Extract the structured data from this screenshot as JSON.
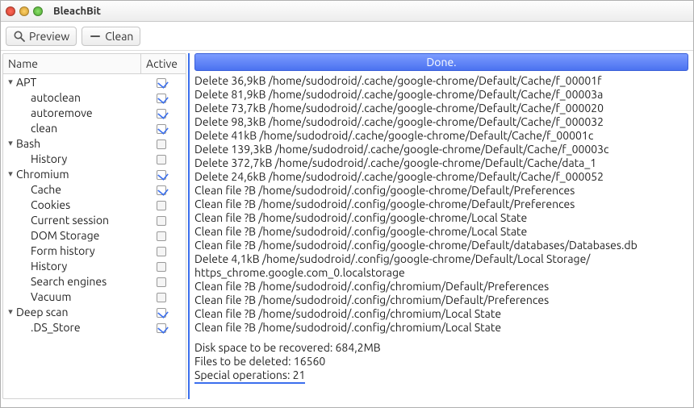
{
  "window": {
    "title": "BleachBit"
  },
  "toolbar": {
    "preview_label": "Preview",
    "clean_label": "Clean"
  },
  "tree": {
    "columns": {
      "name": "Name",
      "active": "Active"
    },
    "rows": [
      {
        "label": "APT",
        "level": 0,
        "checked": true,
        "expander": "▾"
      },
      {
        "label": "autoclean",
        "level": 1,
        "checked": true
      },
      {
        "label": "autoremove",
        "level": 1,
        "checked": true
      },
      {
        "label": "clean",
        "level": 1,
        "checked": true
      },
      {
        "label": "Bash",
        "level": 0,
        "checked": false,
        "expander": "▾"
      },
      {
        "label": "History",
        "level": 1,
        "checked": false
      },
      {
        "label": "Chromium",
        "level": 0,
        "checked": true,
        "expander": "▾"
      },
      {
        "label": "Cache",
        "level": 1,
        "checked": true
      },
      {
        "label": "Cookies",
        "level": 1,
        "checked": false
      },
      {
        "label": "Current session",
        "level": 1,
        "checked": false
      },
      {
        "label": "DOM Storage",
        "level": 1,
        "checked": false
      },
      {
        "label": "Form history",
        "level": 1,
        "checked": false
      },
      {
        "label": "History",
        "level": 1,
        "checked": false
      },
      {
        "label": "Search engines",
        "level": 1,
        "checked": false
      },
      {
        "label": "Vacuum",
        "level": 1,
        "checked": false
      },
      {
        "label": "Deep scan",
        "level": 0,
        "checked": true,
        "expander": "▾"
      },
      {
        "label": ".DS_Store",
        "level": 1,
        "checked": true
      }
    ]
  },
  "progress": {
    "status": "Done."
  },
  "log": {
    "lines": [
      "Delete 36,9kB /home/sudodroid/.cache/google-chrome/Default/Cache/f_00001f",
      "Delete 81,9kB /home/sudodroid/.cache/google-chrome/Default/Cache/f_00003a",
      "Delete 73,7kB /home/sudodroid/.cache/google-chrome/Default/Cache/f_000020",
      "Delete 98,3kB /home/sudodroid/.cache/google-chrome/Default/Cache/f_000032",
      "Delete 41kB /home/sudodroid/.cache/google-chrome/Default/Cache/f_00001c",
      "Delete 139,3kB /home/sudodroid/.cache/google-chrome/Default/Cache/f_00003c",
      "Delete 372,7kB /home/sudodroid/.cache/google-chrome/Default/Cache/data_1",
      "Delete 24,6kB /home/sudodroid/.cache/google-chrome/Default/Cache/f_000052",
      "Clean file ?B /home/sudodroid/.config/google-chrome/Default/Preferences",
      "Clean file ?B /home/sudodroid/.config/google-chrome/Default/Preferences",
      "Clean file ?B /home/sudodroid/.config/google-chrome/Local State",
      "Clean file ?B /home/sudodroid/.config/google-chrome/Local State",
      "Clean file ?B /home/sudodroid/.config/google-chrome/Default/databases/Databases.db",
      "Delete 4,1kB /home/sudodroid/.config/google-chrome/Default/Local Storage/",
      "https_chrome.google.com_0.localstorage",
      "Clean file ?B /home/sudodroid/.config/chromium/Default/Preferences",
      "Clean file ?B /home/sudodroid/.config/chromium/Default/Preferences",
      "Clean file ?B /home/sudodroid/.config/chromium/Local State",
      "Clean file ?B /home/sudodroid/.config/chromium/Local State"
    ],
    "summary": [
      "Disk space to be recovered: 684,2MB",
      "Files to be deleted: 16560",
      "Special operations: 21"
    ]
  }
}
